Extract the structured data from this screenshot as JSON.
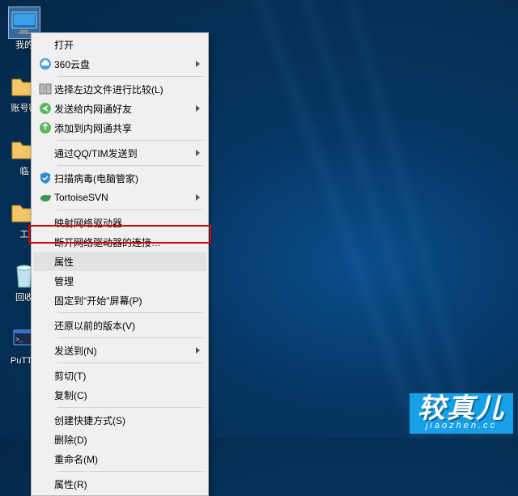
{
  "desktop_icons": [
    {
      "label": "我的",
      "kind": "computer",
      "selected": true
    },
    {
      "label": "账号密",
      "kind": "folder"
    },
    {
      "label": "临",
      "kind": "folder"
    },
    {
      "label": "工",
      "kind": "folder"
    },
    {
      "label": "回收",
      "kind": "recycle"
    },
    {
      "label": "PuTTY",
      "kind": "putty"
    }
  ],
  "context_menu": [
    {
      "label": "打开",
      "icon": null,
      "submenu": false,
      "sep_after": false
    },
    {
      "label": "360云盘",
      "icon": "cloud",
      "submenu": true,
      "sep_after": true
    },
    {
      "label": "选择左边文件进行比较(L)",
      "icon": "compare",
      "submenu": false,
      "sep_after": false
    },
    {
      "label": "发送给内网通好友",
      "icon": "send",
      "submenu": true,
      "sep_after": false
    },
    {
      "label": "添加到内网通共享",
      "icon": "share",
      "submenu": false,
      "sep_after": true
    },
    {
      "label": "通过QQ/TIM发送到",
      "icon": "blank",
      "submenu": true,
      "sep_after": true
    },
    {
      "label": "扫描病毒(电脑管家)",
      "icon": "shield",
      "submenu": false,
      "sep_after": false
    },
    {
      "label": "TortoiseSVN",
      "icon": "tortoise",
      "submenu": true,
      "sep_after": true
    },
    {
      "label": "映射网络驱动器…",
      "icon": null,
      "submenu": false,
      "sep_after": false
    },
    {
      "label": "断开网络驱动器的连接…",
      "icon": null,
      "submenu": false,
      "sep_after": false
    },
    {
      "label": "属性",
      "icon": null,
      "submenu": false,
      "sep_after": false,
      "highlight": true
    },
    {
      "label": "管理",
      "icon": null,
      "submenu": false,
      "sep_after": false
    },
    {
      "label": "固定到\"开始\"屏幕(P)",
      "icon": null,
      "submenu": false,
      "sep_after": true
    },
    {
      "label": "还原以前的版本(V)",
      "icon": null,
      "submenu": false,
      "sep_after": true
    },
    {
      "label": "发送到(N)",
      "icon": null,
      "submenu": true,
      "sep_after": true
    },
    {
      "label": "剪切(T)",
      "icon": null,
      "submenu": false,
      "sep_after": false
    },
    {
      "label": "复制(C)",
      "icon": null,
      "submenu": false,
      "sep_after": true
    },
    {
      "label": "创建快捷方式(S)",
      "icon": null,
      "submenu": false,
      "sep_after": false
    },
    {
      "label": "删除(D)",
      "icon": null,
      "submenu": false,
      "sep_after": false
    },
    {
      "label": "重命名(M)",
      "icon": null,
      "submenu": false,
      "sep_after": true
    },
    {
      "label": "属性(R)",
      "icon": null,
      "submenu": false,
      "sep_after": false
    }
  ],
  "watermark": {
    "main": "较真儿",
    "sub": "jiaozhen.cc"
  }
}
